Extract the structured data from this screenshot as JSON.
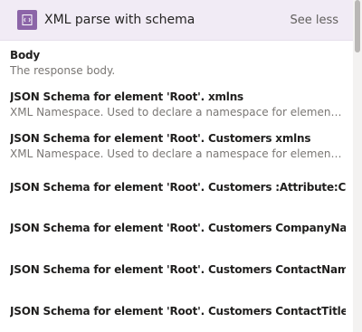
{
  "header": {
    "title": "XML parse with schema",
    "toggle_label": "See less",
    "icon": "xml-icon",
    "accent_color": "#8c65a8"
  },
  "items": [
    {
      "name": "Body",
      "description": "The response body."
    },
    {
      "name": "JSON Schema for element 'Root'. xmlns",
      "description": "XML Namespace. Used to declare a namespace for elements in an ..."
    },
    {
      "name": "JSON Schema for element 'Root'. Customers xmlns",
      "description": "XML Namespace. Used to declare a namespace for elements in an ..."
    },
    {
      "name": "JSON Schema for element 'Root'. Customers :Attribute:CustomerID",
      "description": ""
    },
    {
      "name": "JSON Schema for element 'Root'. Customers CompanyName",
      "description": ""
    },
    {
      "name": "JSON Schema for element 'Root'. Customers ContactName",
      "description": ""
    },
    {
      "name": "JSON Schema for element 'Root'. Customers ContactTitle",
      "description": ""
    }
  ]
}
